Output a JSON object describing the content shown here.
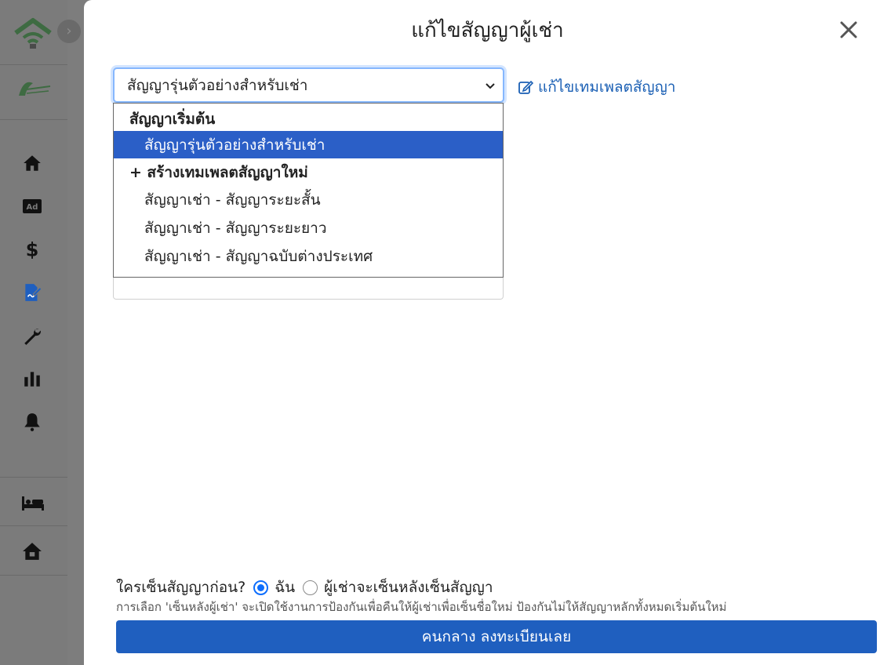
{
  "colors": {
    "overlay": "#7d7d7d",
    "accent": "#1f5fbf",
    "selected_option": "#2b5fc7",
    "link": "#1a5fb4",
    "logo_green": "#3e8a4a"
  },
  "sidebar": {
    "icons": [
      "wifi-home-logo",
      "brand-logo",
      "home-icon",
      "ad-icon",
      "dollar-icon",
      "contract-icon",
      "wrench-icon",
      "chart-icon",
      "bell-icon",
      "bed-icon",
      "house-icon"
    ],
    "ad_label": "Ad"
  },
  "modal": {
    "title": "แก้ไขสัญญาผู้เช่า",
    "close_icon": "close-icon",
    "select": {
      "value": "สัญญารุ่นตัวอย่างสำหรับเช่า"
    },
    "edit_template_link": "แก้ไขเทมเพลตสัญญา",
    "dropdown": {
      "group_label": "สัญญาเริ่มต้น",
      "selected_option": "สัญญารุ่นตัวอย่างสำหรับเช่า",
      "create_new": "+ สร้างเทมเพลตสัญญาใหม่",
      "options": [
        "สัญญาเช่า - สัญญาระยะสั้น",
        "สัญญาเช่า - สัญญาระยะยาว",
        "สัญญาเช่า - สัญญาฉบับต่างประเทศ"
      ]
    },
    "signer": {
      "question": "ใครเซ็นสัญญาก่อน?",
      "option_me": "ฉัน",
      "option_tenant": "ผู้เช่าจะเซ็นหลังเซ็นสัญญา",
      "selected": "ฉัน"
    },
    "hint": "การเลือก 'เซ็นหลังผู้เช่า' จะเปิดใช้งานการป้องกันเพื่อคืนให้ผู้เช่าเพื่อเซ็นชื่อใหม่ ป้องกันไม่ให้สัญญาหลักทั้งหมดเริ่มต้นใหม่",
    "submit_label": "คนกลาง ลงทะเบียนเลย"
  }
}
